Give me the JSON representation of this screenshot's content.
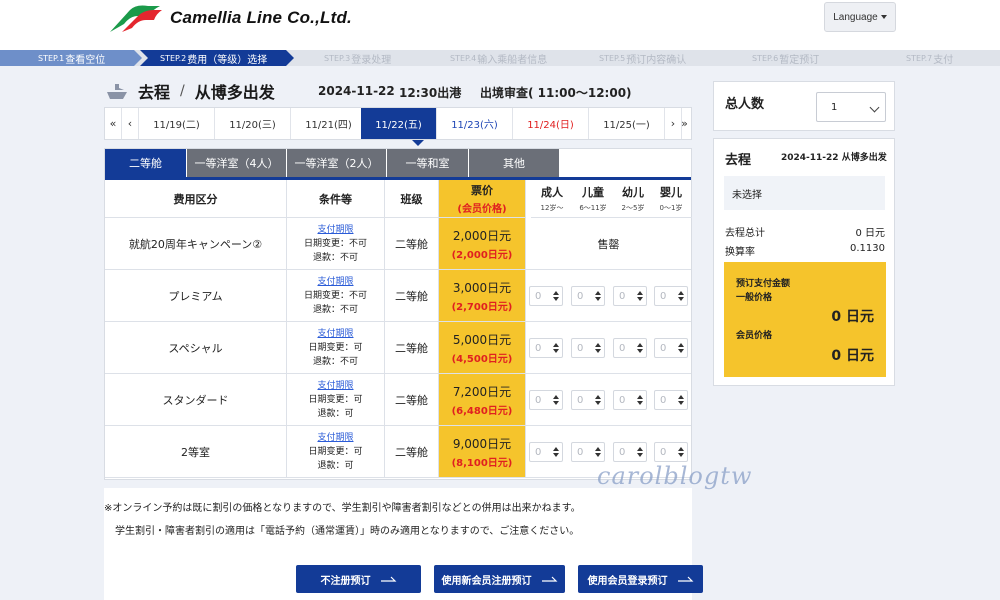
{
  "header": {
    "brand": "Camellia Line Co.,Ltd.",
    "language_label": "Language"
  },
  "steps": [
    {
      "num": "STEP.1",
      "label": "查看空位"
    },
    {
      "num": "STEP.2",
      "label": "费用（等级）选择"
    },
    {
      "num": "STEP.3",
      "label": "登录处理"
    },
    {
      "num": "STEP.4",
      "label": "输入乘船者信息"
    },
    {
      "num": "STEP.5",
      "label": "预订内容确认"
    },
    {
      "num": "STEP.6",
      "label": "暂定预订"
    },
    {
      "num": "STEP.7",
      "label": "支付"
    }
  ],
  "route": {
    "title": "去程",
    "separator": "/",
    "from": "从博多出发",
    "date": "2024-11-22",
    "departure": "12:30出港",
    "checkin": "出境审查( 11:00〜12:00)"
  },
  "datebar": {
    "first": "«",
    "prev": "‹",
    "next": "›",
    "last": "»",
    "dates": [
      "11/19(二)",
      "11/20(三)",
      "11/21(四)",
      "11/22(五)",
      "11/23(六)",
      "11/24(日)",
      "11/25(一)"
    ]
  },
  "tabs": [
    "二等舱",
    "一等洋室（4人）",
    "一等洋室（2人）",
    "一等和室",
    "其他"
  ],
  "table": {
    "headers": {
      "fare_type": "费用区分",
      "conditions": "条件等",
      "class": "班级",
      "price": "票价",
      "price_sub": "(会员价格)"
    },
    "pax": [
      {
        "label": "成人",
        "age": "12岁〜"
      },
      {
        "label": "儿童",
        "age": "6〜11岁"
      },
      {
        "label": "幼儿",
        "age": "2〜5岁"
      },
      {
        "label": "婴儿",
        "age": "0〜1岁"
      }
    ],
    "rows": [
      {
        "name": "就航20周年キャンペーン②",
        "link": "支付期限",
        "change": "日期变更：不可",
        "refund": "退款：不可",
        "class": "二等舱",
        "price": "2,000日元",
        "member": "(2,000日元)",
        "soldout": "售罄"
      },
      {
        "name": "プレミアム",
        "link": "支付期限",
        "change": "日期变更：不可",
        "refund": "退款：不可",
        "class": "二等舱",
        "price": "3,000日元",
        "member": "(2,700日元)"
      },
      {
        "name": "スペシャル",
        "link": "支付期限",
        "change": "日期变更：可",
        "refund": "退款：不可",
        "class": "二等舱",
        "price": "5,000日元",
        "member": "(4,500日元)"
      },
      {
        "name": "スタンダード",
        "link": "支付期限",
        "change": "日期变更：可",
        "refund": "退款：可",
        "class": "二等舱",
        "price": "7,200日元",
        "member": "(6,480日元)"
      },
      {
        "name": "2等室",
        "link": "支付期限",
        "change": "日期变更：可",
        "refund": "退款：可",
        "class": "二等舱",
        "price": "9,000日元",
        "member": "(8,100日元)"
      }
    ],
    "spinner_value": "0"
  },
  "notes": {
    "line1": "※オンライン予約は既に割引の価格となりますので、学生割引や障害者割引などとの併用は出来かねます。",
    "line2": "学生割引・障害者割引の適用は「電話予約（通常運賃）」時のみ適用となりますので、ご注意ください。"
  },
  "buttons": {
    "no_register": "不注册预订",
    "new_member": "使用新会员注册预订",
    "member_login": "使用会员登录预订"
  },
  "watermark": "carolblogtw",
  "summary": {
    "pax_label": "总人数",
    "pax_value": "1",
    "title": "去程",
    "date_from": "2024-11-22 从博多出发",
    "unselected": "未选择",
    "total_label": "去程总计",
    "total_value": "0 日元",
    "rate_label": "换算率",
    "rate_value": "0.1130",
    "pay_label": "预订支付金额",
    "general_label": "一般价格",
    "general_value": "0 日元",
    "member_label": "会员价格",
    "member_value": "0 日元"
  },
  "colors": {
    "primary": "#133b97",
    "accent_yellow": "#f5c42c",
    "sunday_red": "#e02020",
    "saturday_blue": "#1f46b5",
    "logo_red": "#e4262e",
    "logo_green": "#1b9a4a"
  }
}
